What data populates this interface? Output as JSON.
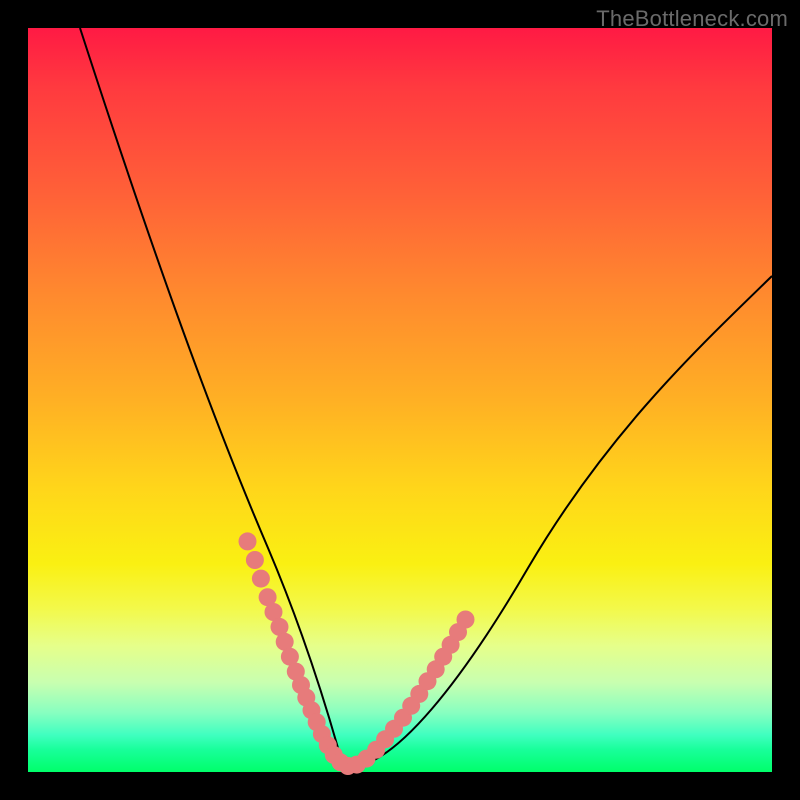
{
  "watermark": "TheBottleneck.com",
  "chart_data": {
    "type": "line",
    "title": "",
    "xlabel": "",
    "ylabel": "",
    "xlim": [
      0,
      100
    ],
    "ylim": [
      0,
      100
    ],
    "grid": false,
    "series": [
      {
        "name": "v-curve",
        "x": [
          7,
          12,
          18,
          23,
          27,
          30,
          33,
          35.5,
          37.5,
          39,
          40,
          41,
          43,
          46,
          50,
          55,
          60,
          66,
          73,
          80,
          88,
          96,
          100
        ],
        "y": [
          100,
          85,
          67,
          53,
          41,
          32,
          24,
          17,
          11,
          6,
          3,
          1,
          1,
          3,
          7,
          13,
          20,
          28,
          37,
          46,
          55,
          63,
          67
        ]
      }
    ],
    "markers": {
      "name": "pink-dots",
      "color": "#e77b7b",
      "points": [
        {
          "x": 29.5,
          "y": 31
        },
        {
          "x": 30.5,
          "y": 28.5
        },
        {
          "x": 31.3,
          "y": 26
        },
        {
          "x": 32.2,
          "y": 23.5
        },
        {
          "x": 33.0,
          "y": 21.5
        },
        {
          "x": 33.8,
          "y": 19.5
        },
        {
          "x": 34.5,
          "y": 17.5
        },
        {
          "x": 35.2,
          "y": 15.5
        },
        {
          "x": 36.0,
          "y": 13.5
        },
        {
          "x": 36.7,
          "y": 11.7
        },
        {
          "x": 37.4,
          "y": 10.0
        },
        {
          "x": 38.1,
          "y": 8.3
        },
        {
          "x": 38.8,
          "y": 6.7
        },
        {
          "x": 39.5,
          "y": 5.1
        },
        {
          "x": 40.3,
          "y": 3.6
        },
        {
          "x": 41.1,
          "y": 2.3
        },
        {
          "x": 42.0,
          "y": 1.3
        },
        {
          "x": 43.0,
          "y": 0.8
        },
        {
          "x": 44.2,
          "y": 1.0
        },
        {
          "x": 45.5,
          "y": 1.8
        },
        {
          "x": 46.8,
          "y": 3.0
        },
        {
          "x": 48.0,
          "y": 4.4
        },
        {
          "x": 49.2,
          "y": 5.8
        },
        {
          "x": 50.4,
          "y": 7.3
        },
        {
          "x": 51.5,
          "y": 8.9
        },
        {
          "x": 52.6,
          "y": 10.5
        },
        {
          "x": 53.7,
          "y": 12.2
        },
        {
          "x": 54.8,
          "y": 13.8
        },
        {
          "x": 55.8,
          "y": 15.5
        },
        {
          "x": 56.8,
          "y": 17.1
        },
        {
          "x": 57.8,
          "y": 18.8
        },
        {
          "x": 58.8,
          "y": 20.5
        }
      ]
    },
    "background_gradient": {
      "type": "vertical",
      "stops": [
        {
          "pos": 0.0,
          "color": "#ff1a44"
        },
        {
          "pos": 0.5,
          "color": "#ffb024"
        },
        {
          "pos": 0.75,
          "color": "#f3f94a"
        },
        {
          "pos": 1.0,
          "color": "#00ff6a"
        }
      ]
    }
  }
}
